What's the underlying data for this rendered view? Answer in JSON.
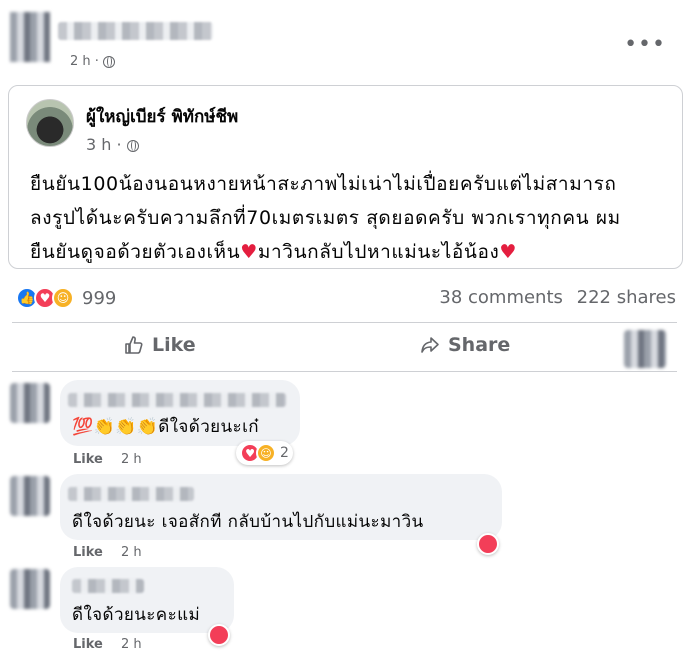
{
  "post": {
    "time": "2 h ·",
    "more_label": "•••"
  },
  "shared": {
    "name": "ผู้ใหญ่เบียร์ พิทักษ์ชีพ",
    "time": "3 h ·",
    "text_line1": "ยืนยัน100น้องนอนหงายหน้าสะภาพไม่เน่าไม่เปื่อยครับแต่ไม่สามารถ",
    "text_line2": "ลงรูปได้นะครับความลึกที่70เมตรเมตร สุดยอดครับ พวกเราทุกคน ผม",
    "text_line3a": "ยืนยันดูจอด้วยตัวเองเห็น",
    "text_line3b": "มาวินกลับไปหาแม่นะไอ้น้อง",
    "heart": "♥"
  },
  "stats": {
    "reaction_count": "999",
    "comments": "38 comments",
    "shares": "222 shares"
  },
  "actions": {
    "like": "Like",
    "share": "Share"
  },
  "comments": [
    {
      "text": "💯👏👏👏ดีใจด้วยนะเก๋",
      "like": "Like",
      "time": "2 h",
      "reaction_count": "2"
    },
    {
      "text": "ดีใจด้วยนะ เจอสักที กลับบ้านไปกับแม่นะมาวิน",
      "like": "Like",
      "time": "2 h"
    },
    {
      "text": "ดีใจด้วยนะคะแม่",
      "like": "Like",
      "time": "2 h"
    }
  ],
  "colors": {
    "accent": "#1877f2",
    "love": "#f33e58",
    "care": "#f7b125",
    "muted": "#65676b"
  }
}
